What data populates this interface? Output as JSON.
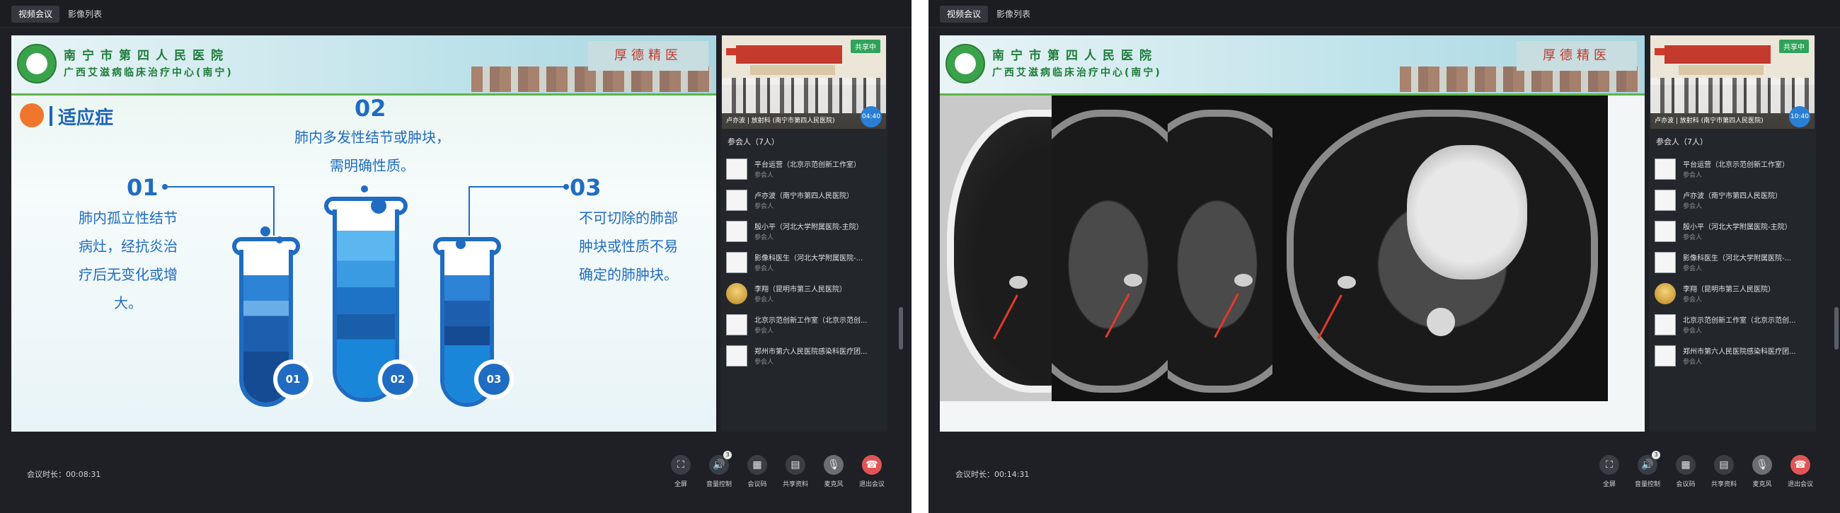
{
  "panels": [
    {
      "tabs": [
        {
          "label": "视频会议",
          "active": true
        },
        {
          "label": "影像列表",
          "active": false
        }
      ],
      "slide": {
        "hospital_name": "南宁市第四人民医院",
        "center_name": "广西艾滋病临床治疗中心(南宁)",
        "calligraphy": "厚德精医",
        "title": "适应症",
        "items": [
          {
            "number": "01",
            "lines": [
              "肺内孤立性结节",
              "病灶，经抗炎治",
              "疗后无变化或增",
              "大。"
            ]
          },
          {
            "number": "02",
            "lines": [
              "肺内多发性结节或肿块，",
              "需明确性质。"
            ]
          },
          {
            "number": "03",
            "lines": [
              "不可切除的肺部",
              "肿块或性质不易",
              "确定的肺肿块。"
            ]
          }
        ],
        "tube_labels": [
          "01",
          "02",
          "03"
        ]
      },
      "video": {
        "share_tag": "共享中",
        "caption": "卢亦波 | 放射科 (南宁市第四人民医院)",
        "timer": "04:40"
      },
      "participants_count": "参会人（7人）",
      "participants": [
        {
          "name": "平台运营（北京示范创新工作室）",
          "role": "参会人"
        },
        {
          "name": "卢亦波（南宁市第四人民医院）",
          "role": "参会人"
        },
        {
          "name": "殷小平（河北大学附属医院-主院）",
          "role": "参会人"
        },
        {
          "name": "影像科医生（河北大学附属医院-...",
          "role": "参会人"
        },
        {
          "name": "李翔（昆明市第三人民医院）",
          "role": "参会人"
        },
        {
          "name": "北京示范创新工作室（北京示范创...",
          "role": "参会人"
        },
        {
          "name": "郑州市第六人民医院感染科医疗团...",
          "role": "参会人"
        }
      ],
      "duration_label": "会议时长：",
      "duration": "00:08:31",
      "controls": [
        {
          "label": "全屏",
          "icon": "fullscreen-icon",
          "glyph": "⛶"
        },
        {
          "label": "音量控制",
          "icon": "speaker-icon",
          "glyph": "🔊",
          "badge": "3"
        },
        {
          "label": "会议码",
          "icon": "qr-code-icon",
          "glyph": "▦"
        },
        {
          "label": "共享资料",
          "icon": "document-icon",
          "glyph": "▤"
        },
        {
          "label": "麦克风",
          "icon": "microphone-icon",
          "glyph": "🎙"
        },
        {
          "label": "退出会议",
          "icon": "hangup-icon",
          "glyph": "☎"
        }
      ]
    },
    {
      "tabs": [
        {
          "label": "视频会议",
          "active": true
        },
        {
          "label": "影像列表",
          "active": false
        }
      ],
      "slide": {
        "hospital_name": "南宁市第四人民医院",
        "center_name": "广西艾滋病临床治疗中心(南宁)",
        "calligraphy": "厚德精医"
      },
      "video": {
        "share_tag": "共享中",
        "caption": "卢亦波 | 放射科 (南宁市第四人民医院)",
        "timer": "10:40"
      },
      "participants_count": "参会人（7人）",
      "participants": [
        {
          "name": "平台运营（北京示范创新工作室）",
          "role": "参会人"
        },
        {
          "name": "卢亦波（南宁市第四人民医院）",
          "role": "参会人"
        },
        {
          "name": "殷小平（河北大学附属医院-主院）",
          "role": "参会人"
        },
        {
          "name": "影像科医生（河北大学附属医院-...",
          "role": "参会人"
        },
        {
          "name": "李翔（昆明市第三人民医院）",
          "role": "参会人"
        },
        {
          "name": "北京示范创新工作室（北京示范创...",
          "role": "参会人"
        },
        {
          "name": "郑州市第六人民医院感染科医疗团...",
          "role": "参会人"
        }
      ],
      "duration_label": "会议时长：",
      "duration": "00:14:31",
      "controls": [
        {
          "label": "全屏",
          "icon": "fullscreen-icon",
          "glyph": "⛶"
        },
        {
          "label": "音量控制",
          "icon": "speaker-icon",
          "glyph": "🔊",
          "badge": "3"
        },
        {
          "label": "会议码",
          "icon": "qr-code-icon",
          "glyph": "▦"
        },
        {
          "label": "共享资料",
          "icon": "document-icon",
          "glyph": "▤"
        },
        {
          "label": "麦克风",
          "icon": "microphone-icon",
          "glyph": "🎙"
        },
        {
          "label": "退出会议",
          "icon": "hangup-icon",
          "glyph": "☎"
        }
      ]
    }
  ]
}
